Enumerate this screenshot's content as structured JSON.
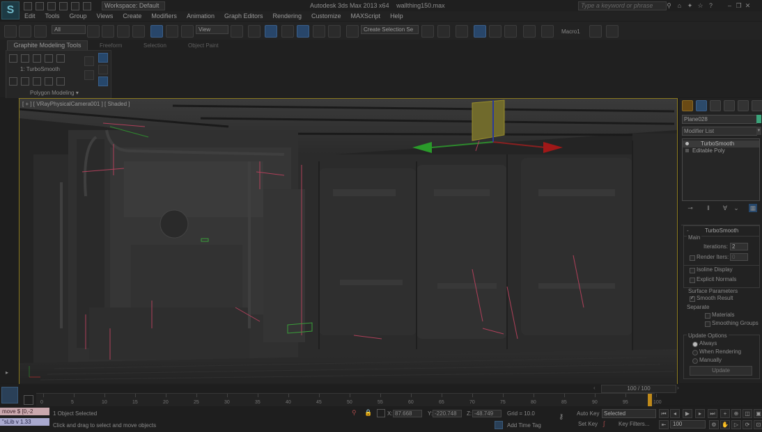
{
  "titlebar": {
    "workspace": "Workspace: Default",
    "app_title": "Autodesk 3ds Max  2013 x64",
    "file_name": "wallthing150.max",
    "search_placeholder": "Type a keyword or phrase"
  },
  "menubar": [
    "Edit",
    "Tools",
    "Group",
    "Views",
    "Create",
    "Modifiers",
    "Animation",
    "Graph Editors",
    "Rendering",
    "Customize",
    "MAXScript",
    "Help"
  ],
  "toolbar": {
    "selection_filter": "All",
    "ref_coord": "View",
    "named_selection": "Create Selection Se",
    "macro_label": "Macro1"
  },
  "ribbon": {
    "tabs": [
      "Graphite Modeling Tools",
      "Freeform",
      "Selection",
      "Object Paint"
    ],
    "stack_label": "1: TurboSmooth",
    "panel_title": "Polygon Modeling"
  },
  "viewport": {
    "label": "[ + ] [ VRayPhysicalCamera001 ] [ Shaded ]"
  },
  "command_panel": {
    "object_name": "Plane028",
    "object_color": "#3ba37a",
    "modifier_list_label": "Modifier List",
    "stack": [
      "TurboSmooth",
      "Editable Poly"
    ],
    "rollout_title": "TurboSmooth",
    "main_label": "Main",
    "iterations_label": "Iterations:",
    "iterations_value": "2",
    "render_iters_label": "Render Iters:",
    "render_iters_value": "0",
    "isoline_label": "Isoline Display",
    "explicit_normals_label": "Explicit Normals",
    "surface_label": "Surface Parameters",
    "smooth_result_label": "Smooth Result",
    "separate_label": "Separate",
    "materials_label": "Materials",
    "smoothing_groups_label": "Smoothing Groups",
    "update_options_label": "Update Options",
    "always_label": "Always",
    "when_rendering_label": "When Rendering",
    "manually_label": "Manually",
    "update_button": "Update"
  },
  "timeline": {
    "slider_text": "100 / 100",
    "ticks": [
      "0",
      "5",
      "10",
      "15",
      "20",
      "25",
      "30",
      "35",
      "40",
      "45",
      "50",
      "55",
      "60",
      "65",
      "70",
      "75",
      "80",
      "85",
      "90",
      "95",
      "100"
    ]
  },
  "status": {
    "maxscript_line1": "move $ [0,-2",
    "maxscript_line2": "\"sLib v 1.33",
    "selection_info": "1 Object Selected",
    "prompt": "Click and drag to select and move objects",
    "x_label": "X:",
    "x_value": "87.668",
    "y_label": "Y:",
    "y_value": "-220.748",
    "z_label": "Z:",
    "z_value": "-48.749",
    "grid": "Grid = 10.0",
    "add_time_tag": "Add Time Tag",
    "auto_key": "Auto Key",
    "set_key": "Set Key",
    "key_mode": "Selected",
    "key_filters": "Key Filters...",
    "frame_value": "100"
  }
}
